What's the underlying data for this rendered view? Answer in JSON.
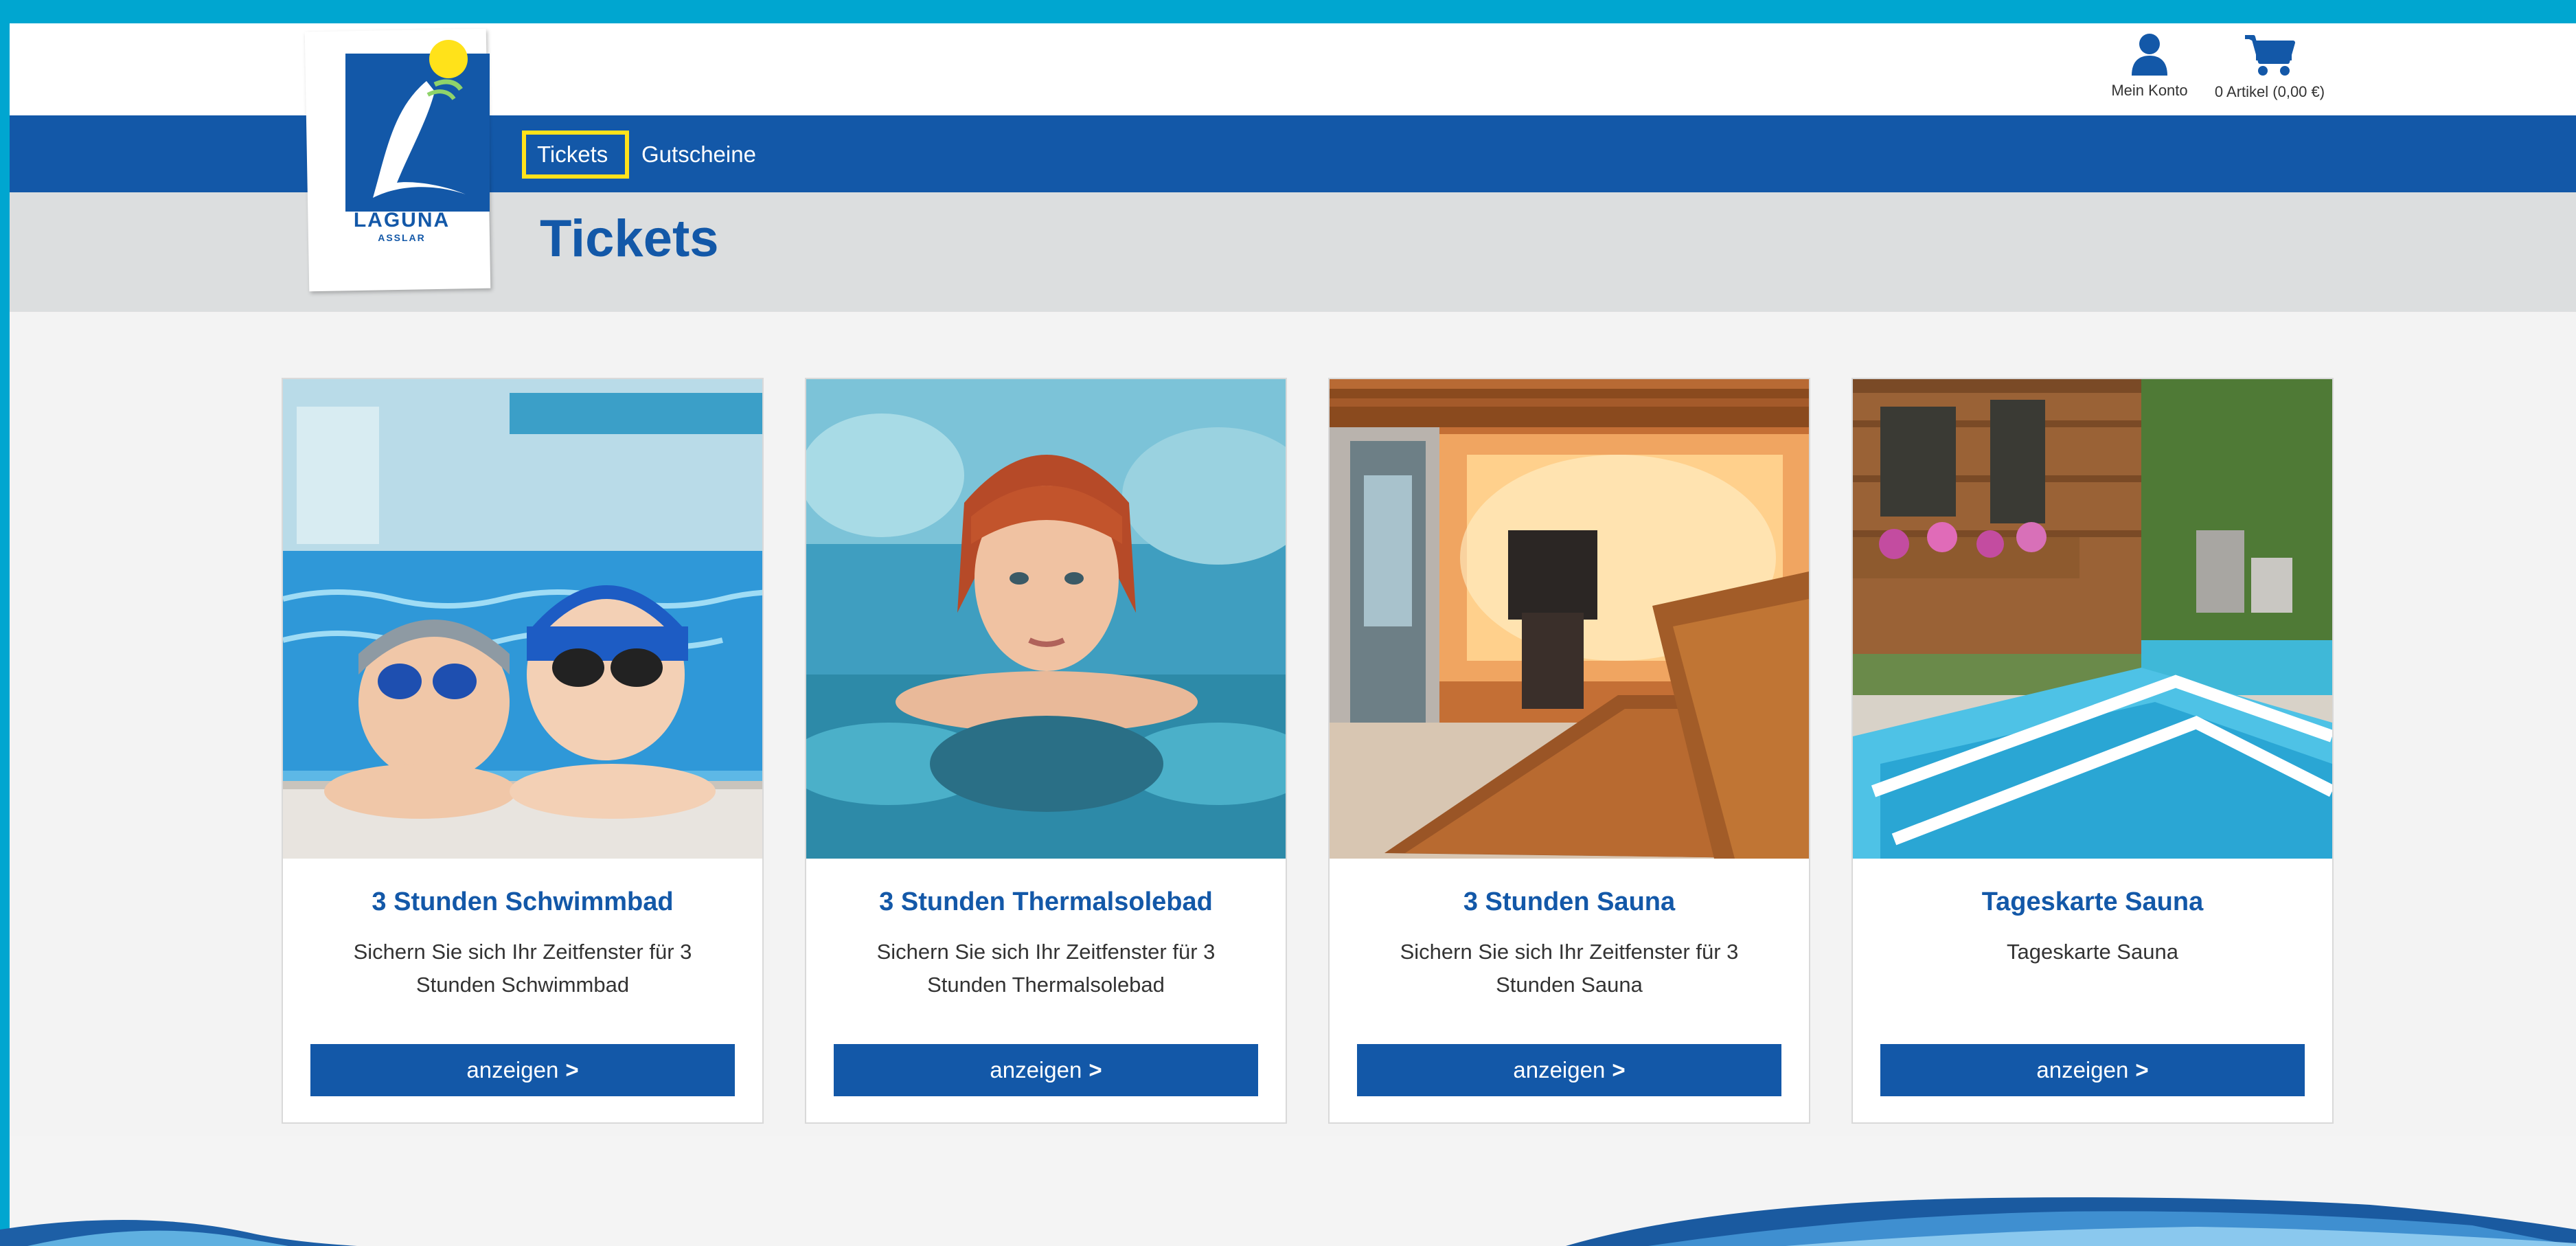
{
  "brand": {
    "name": "LAGUNA",
    "location": "ASSLAR"
  },
  "header": {
    "account_label": "Mein Konto",
    "cart_label": "0 Artikel (0,00 €)"
  },
  "nav": {
    "items": [
      {
        "label": "Tickets",
        "active": true
      },
      {
        "label": "Gutscheine",
        "active": false
      }
    ]
  },
  "page": {
    "title": "Tickets"
  },
  "cards": [
    {
      "title": "3 Stunden Schwimmbad",
      "description": "Sichern Sie sich Ihr Zeitfenster für 3 Stunden Schwimmbad",
      "button": "anzeigen"
    },
    {
      "title": "3 Stunden Thermalsolebad",
      "description": "Sichern Sie sich Ihr Zeitfenster für 3 Stunden Thermalsolebad",
      "button": "anzeigen"
    },
    {
      "title": "3 Stunden Sauna",
      "description": "Sichern Sie sich Ihr Zeitfenster für 3 Stunden Sauna",
      "button": "anzeigen"
    },
    {
      "title": "Tageskarte Sauna",
      "description": "Tageskarte Sauna",
      "button": "anzeigen"
    }
  ],
  "colors": {
    "frame": "#00a6d0",
    "primary": "#1358a8",
    "highlight": "#ffe21a",
    "title_band": "#dcdedf"
  },
  "icons": {
    "account": "user-icon",
    "cart": "cart-icon",
    "chevron": "chevron-right-icon"
  }
}
